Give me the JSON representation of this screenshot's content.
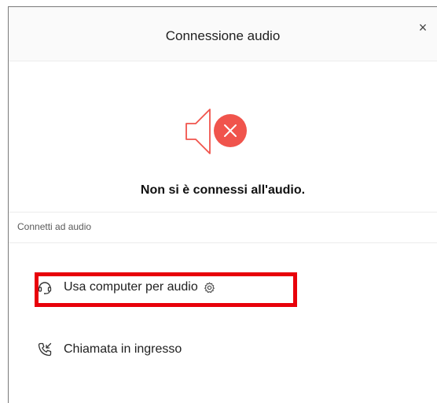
{
  "dialog": {
    "title": "Connessione audio",
    "close_glyph": "×",
    "status_text": "Non si è connessi all'audio.",
    "section_label": "Connetti ad audio",
    "options": [
      {
        "label": "Usa computer per audio",
        "icon": "headset-icon",
        "trailing_icon": "gear-icon"
      },
      {
        "label": "Chiamata in ingresso",
        "icon": "incoming-call-icon"
      }
    ],
    "status_icon": "speaker-muted-icon"
  },
  "colors": {
    "accent_red": "#f0544c",
    "highlight_red": "#e8000a"
  }
}
